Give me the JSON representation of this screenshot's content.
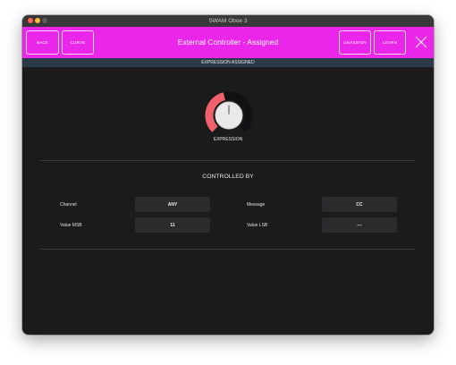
{
  "window": {
    "title": "SWAM Oboe 3"
  },
  "topbar": {
    "back_label": "BACK",
    "curve_label": "CURVE",
    "title": "External Controller - Assigned",
    "unassign_label": "UNASSIGN",
    "learn_label": "LEARN",
    "accent_color": "#ea26ea"
  },
  "status": {
    "text": "EXPRESSION ASSIGNED"
  },
  "knob": {
    "label": "EXPRESSION",
    "value_fraction": 0.45,
    "arc_color": "#f0616b"
  },
  "controlled_by": {
    "title": "CONTROLLED BY",
    "channel_label": "Channel",
    "channel_value": "ANY",
    "message_label": "Message",
    "message_value": "CC",
    "value_msb_label": "Value MSB",
    "value_msb_value": "11",
    "value_lsb_label": "Value LSB",
    "value_lsb_value": "---"
  }
}
